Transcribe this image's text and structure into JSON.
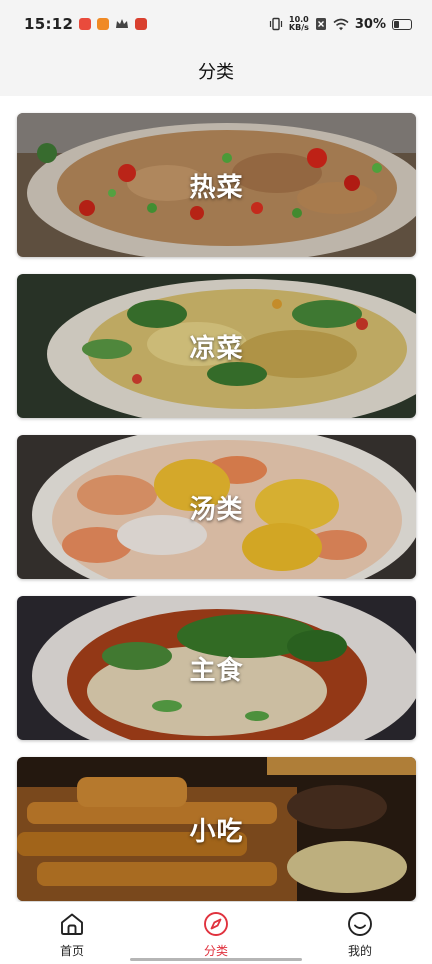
{
  "status_bar": {
    "time": "15:12",
    "net_speed_top": "10.0",
    "net_speed_bottom": "KB/s",
    "battery": "30%"
  },
  "header": {
    "title": "分类"
  },
  "categories": [
    {
      "title": "热菜"
    },
    {
      "title": "凉菜"
    },
    {
      "title": "汤类"
    },
    {
      "title": "主食"
    },
    {
      "title": "小吃"
    }
  ],
  "nav": {
    "items": [
      {
        "label": "首页",
        "icon": "home-icon"
      },
      {
        "label": "分类",
        "icon": "compass-icon",
        "active": true
      },
      {
        "label": "我的",
        "icon": "smile-icon"
      }
    ],
    "active_color": "#e0323e"
  }
}
